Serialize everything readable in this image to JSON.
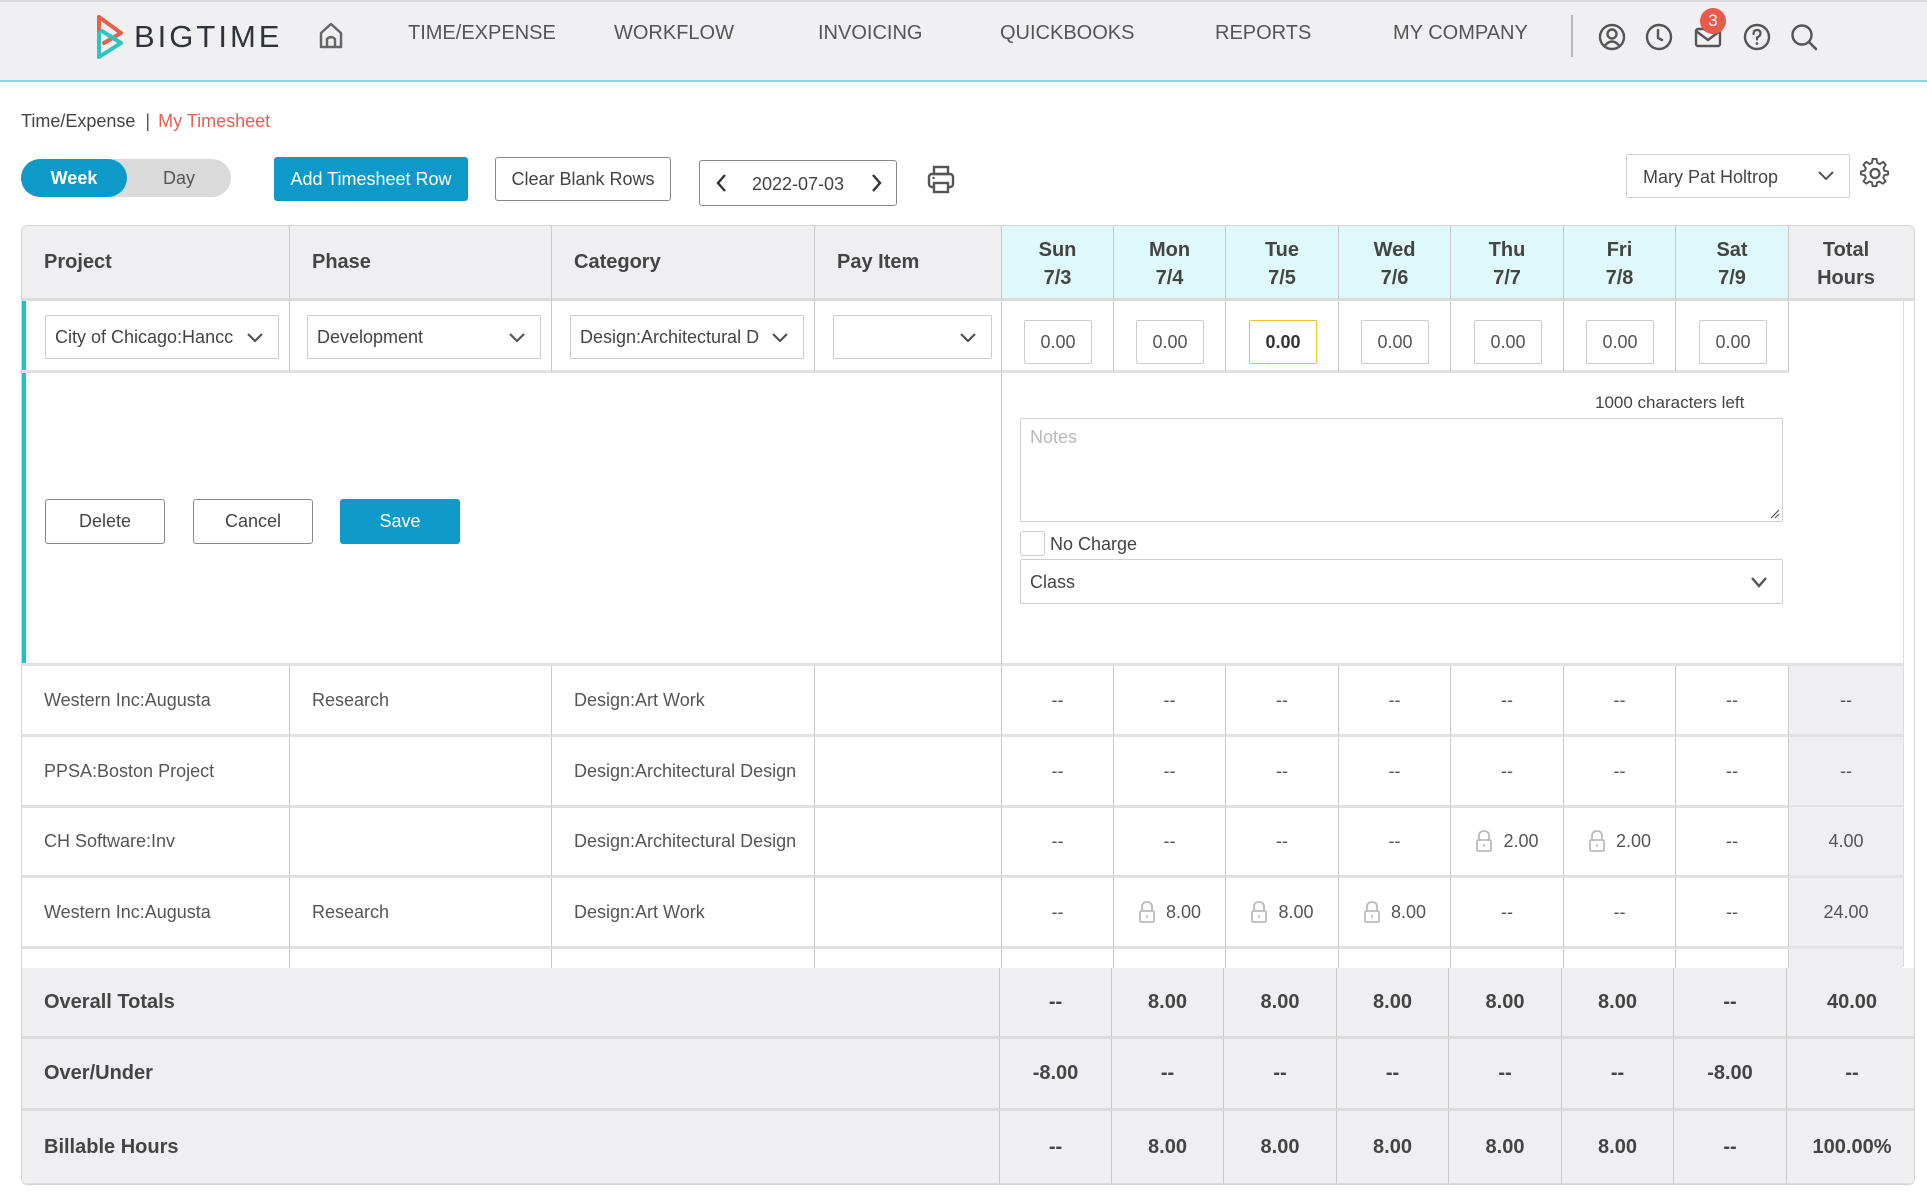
{
  "nav": {
    "brand": "BIGTIME",
    "items": [
      "TIME/EXPENSE",
      "WORKFLOW",
      "INVOICING",
      "QUICKBOOKS",
      "REPORTS",
      "MY COMPANY"
    ],
    "mail_badge": "3",
    "icons": [
      "home-icon",
      "user-icon",
      "clock-icon",
      "mail-icon",
      "help-icon",
      "search-icon"
    ]
  },
  "breadcrumb": {
    "parent": "Time/Expense",
    "separator": "|",
    "current": "My Timesheet"
  },
  "toolbar": {
    "view_week": "Week",
    "view_day": "Day",
    "add_row": "Add Timesheet Row",
    "clear_blank": "Clear Blank Rows",
    "week_date": "2022-07-03",
    "user": "Mary Pat Holtrop"
  },
  "table": {
    "headers": {
      "project": "Project",
      "phase": "Phase",
      "category": "Category",
      "pay_item": "Pay Item",
      "total_line1": "Total",
      "total_line2": "Hours"
    },
    "days": [
      {
        "name": "Sun",
        "date": "7/3"
      },
      {
        "name": "Mon",
        "date": "7/4"
      },
      {
        "name": "Tue",
        "date": "7/5"
      },
      {
        "name": "Wed",
        "date": "7/6"
      },
      {
        "name": "Thu",
        "date": "7/7"
      },
      {
        "name": "Fri",
        "date": "7/8"
      },
      {
        "name": "Sat",
        "date": "7/9"
      }
    ],
    "edit_row": {
      "project": "City of Chicago:Hancc",
      "phase": "Development",
      "category": "Design:Architectural D",
      "pay_item": "",
      "hours": [
        "0.00",
        "0.00",
        "0.00",
        "0.00",
        "0.00",
        "0.00",
        "0.00"
      ],
      "focused_day_index": 2,
      "notes_count": "1000 characters left",
      "notes_placeholder": "Notes",
      "no_charge_label": "No Charge",
      "no_charge_checked": false,
      "class_placeholder": "Class",
      "delete": "Delete",
      "cancel": "Cancel",
      "save": "Save"
    },
    "rows": [
      {
        "project": "Western Inc:Augusta",
        "phase": "Research",
        "category": "Design:Art Work",
        "pay_item": "",
        "hours": [
          "--",
          "--",
          "--",
          "--",
          "--",
          "--",
          "--"
        ],
        "locked": [
          false,
          false,
          false,
          false,
          false,
          false,
          false
        ],
        "total": "--"
      },
      {
        "project": "PPSA:Boston Project",
        "phase": "",
        "category": "Design:Architectural Design",
        "pay_item": "",
        "hours": [
          "--",
          "--",
          "--",
          "--",
          "--",
          "--",
          "--"
        ],
        "locked": [
          false,
          false,
          false,
          false,
          false,
          false,
          false
        ],
        "total": "--"
      },
      {
        "project": "CH Software:Inv",
        "phase": "",
        "category": "Design:Architectural Design",
        "pay_item": "",
        "hours": [
          "--",
          "--",
          "--",
          "--",
          "2.00",
          "2.00",
          "--"
        ],
        "locked": [
          false,
          false,
          false,
          false,
          true,
          true,
          false
        ],
        "total": "4.00"
      },
      {
        "project": "Western Inc:Augusta",
        "phase": "Research",
        "category": "Design:Art Work",
        "pay_item": "",
        "hours": [
          "--",
          "8.00",
          "8.00",
          "8.00",
          "--",
          "--",
          "--"
        ],
        "locked": [
          false,
          true,
          true,
          true,
          false,
          false,
          false
        ],
        "total": "24.00"
      }
    ],
    "footer": [
      {
        "label": "Overall Totals",
        "values": [
          "--",
          "8.00",
          "8.00",
          "8.00",
          "8.00",
          "8.00",
          "--"
        ],
        "total": "40.00"
      },
      {
        "label": "Over/Under",
        "values": [
          "-8.00",
          "--",
          "--",
          "--",
          "--",
          "--",
          "-8.00"
        ],
        "total": "--"
      },
      {
        "label": "Billable Hours",
        "values": [
          "--",
          "8.00",
          "8.00",
          "8.00",
          "8.00",
          "8.00",
          "--"
        ],
        "total": "100.00%"
      }
    ]
  },
  "colors": {
    "accent": "#0e9ac8",
    "breadcrumb_active": "#e7604f",
    "badge": "#e85a4a",
    "day_header_bg": "#dff8fa",
    "edit_row_marker": "#19c4cc",
    "focused_input_border": "#f0c030"
  }
}
